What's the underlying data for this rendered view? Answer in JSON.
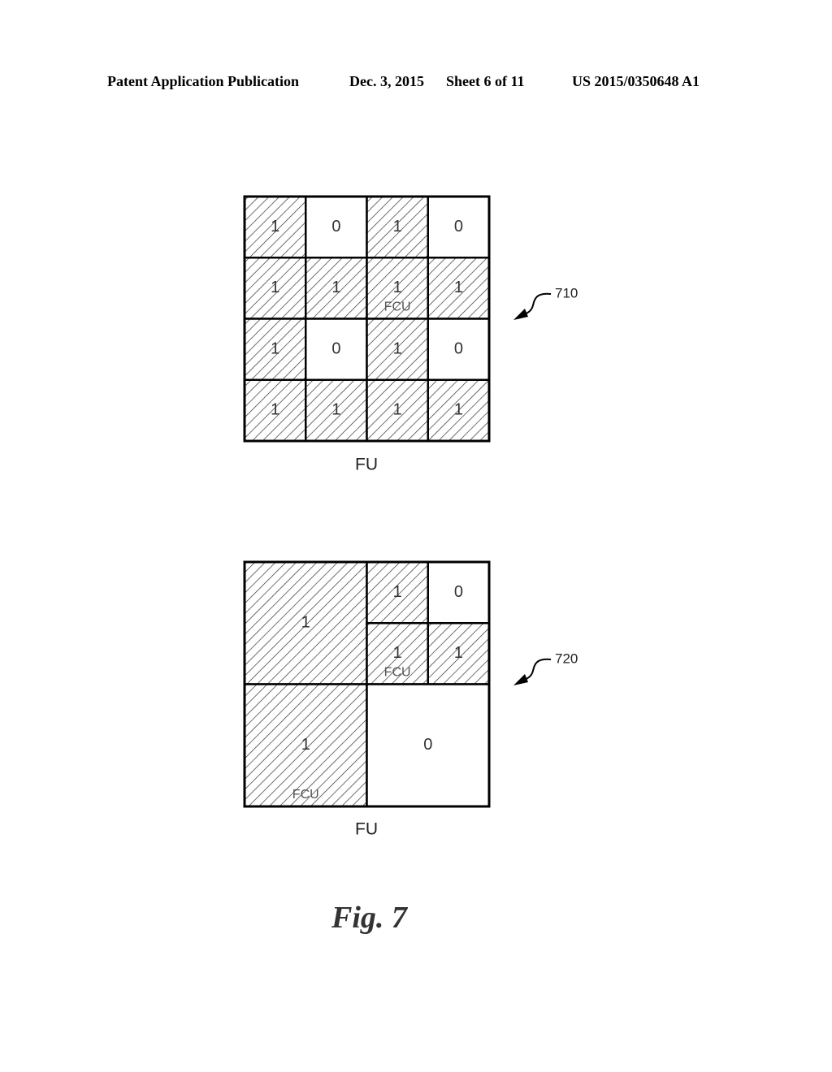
{
  "header": {
    "publication": "Patent Application Publication",
    "date": "Dec. 3, 2015",
    "sheet": "Sheet 6 of 11",
    "number": "US 2015/0350648 A1"
  },
  "figures": [
    {
      "ref": "710",
      "unit_label": "FU",
      "blocks": [
        {
          "row": 0,
          "col": 0,
          "rs": 1,
          "cs": 1,
          "value": "1",
          "hatched": true
        },
        {
          "row": 0,
          "col": 1,
          "rs": 1,
          "cs": 1,
          "value": "0",
          "hatched": false
        },
        {
          "row": 0,
          "col": 2,
          "rs": 1,
          "cs": 1,
          "value": "1",
          "hatched": true
        },
        {
          "row": 0,
          "col": 3,
          "rs": 1,
          "cs": 1,
          "value": "0",
          "hatched": false
        },
        {
          "row": 1,
          "col": 0,
          "rs": 1,
          "cs": 1,
          "value": "1",
          "hatched": true
        },
        {
          "row": 1,
          "col": 1,
          "rs": 1,
          "cs": 1,
          "value": "1",
          "hatched": true
        },
        {
          "row": 1,
          "col": 2,
          "rs": 1,
          "cs": 1,
          "value": "1",
          "hatched": true,
          "sublabel": "FCU"
        },
        {
          "row": 1,
          "col": 3,
          "rs": 1,
          "cs": 1,
          "value": "1",
          "hatched": true
        },
        {
          "row": 2,
          "col": 0,
          "rs": 1,
          "cs": 1,
          "value": "1",
          "hatched": true
        },
        {
          "row": 2,
          "col": 1,
          "rs": 1,
          "cs": 1,
          "value": "0",
          "hatched": false
        },
        {
          "row": 2,
          "col": 2,
          "rs": 1,
          "cs": 1,
          "value": "1",
          "hatched": true
        },
        {
          "row": 2,
          "col": 3,
          "rs": 1,
          "cs": 1,
          "value": "0",
          "hatched": false
        },
        {
          "row": 3,
          "col": 0,
          "rs": 1,
          "cs": 1,
          "value": "1",
          "hatched": true
        },
        {
          "row": 3,
          "col": 1,
          "rs": 1,
          "cs": 1,
          "value": "1",
          "hatched": true
        },
        {
          "row": 3,
          "col": 2,
          "rs": 1,
          "cs": 1,
          "value": "1",
          "hatched": true
        },
        {
          "row": 3,
          "col": 3,
          "rs": 1,
          "cs": 1,
          "value": "1",
          "hatched": true
        }
      ]
    },
    {
      "ref": "720",
      "unit_label": "FU",
      "blocks": [
        {
          "row": 0,
          "col": 0,
          "rs": 2,
          "cs": 2,
          "value": "1",
          "hatched": true
        },
        {
          "row": 0,
          "col": 2,
          "rs": 1,
          "cs": 1,
          "value": "1",
          "hatched": true
        },
        {
          "row": 0,
          "col": 3,
          "rs": 1,
          "cs": 1,
          "value": "0",
          "hatched": false
        },
        {
          "row": 1,
          "col": 2,
          "rs": 1,
          "cs": 1,
          "value": "1",
          "hatched": true,
          "sublabel": "FCU"
        },
        {
          "row": 1,
          "col": 3,
          "rs": 1,
          "cs": 1,
          "value": "1",
          "hatched": true
        },
        {
          "row": 2,
          "col": 0,
          "rs": 2,
          "cs": 2,
          "value": "1",
          "hatched": true,
          "sublabel": "FCU"
        },
        {
          "row": 2,
          "col": 2,
          "rs": 2,
          "cs": 2,
          "value": "0",
          "hatched": false
        }
      ]
    }
  ],
  "caption": "Fig. 7"
}
